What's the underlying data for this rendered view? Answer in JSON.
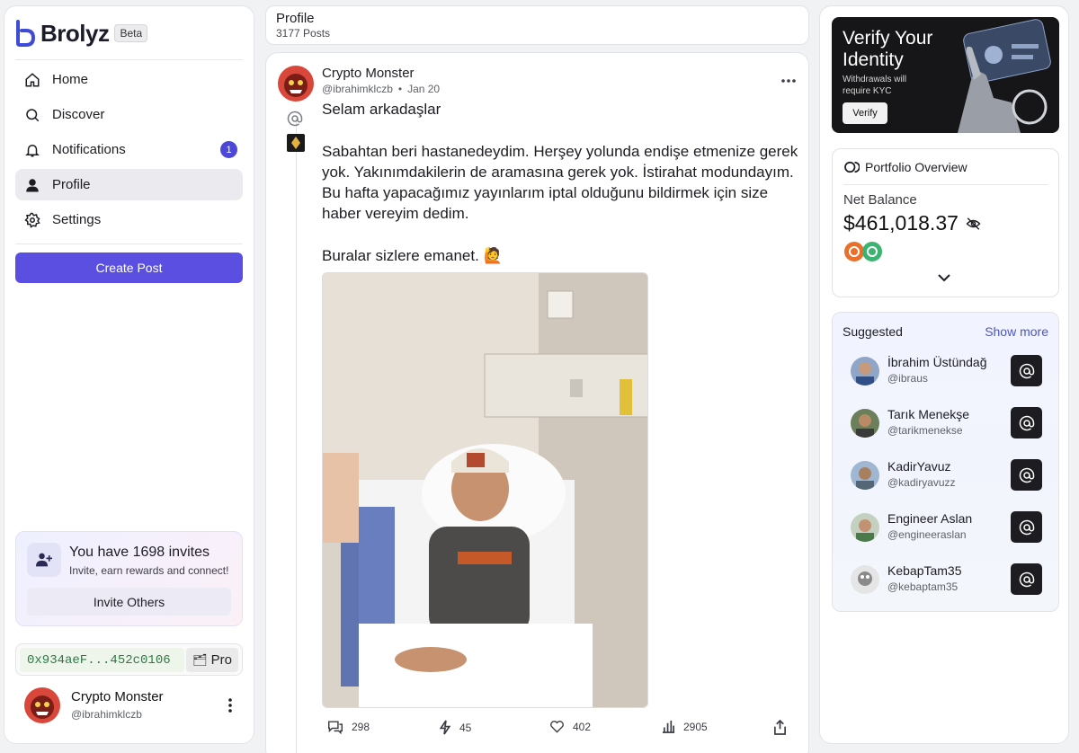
{
  "brand": {
    "name": "Brolyz",
    "badge": "Beta"
  },
  "nav": {
    "items": [
      {
        "label": "Home",
        "icon": "home-icon"
      },
      {
        "label": "Discover",
        "icon": "search-icon"
      },
      {
        "label": "Notifications",
        "icon": "bell-icon",
        "badge": "1"
      },
      {
        "label": "Profile",
        "icon": "user-icon",
        "active": true
      },
      {
        "label": "Settings",
        "icon": "gear-icon"
      }
    ],
    "create_label": "Create Post"
  },
  "invite": {
    "title": "You have 1698 invites",
    "subtitle": "Invite, earn rewards and connect!",
    "button": "Invite Others"
  },
  "wallet": {
    "address": "0x934aeF...452c0106",
    "pro_label": "Pro"
  },
  "current_user": {
    "name": "Crypto Monster",
    "handle": "@ibrahimklczb"
  },
  "profile_header": {
    "title": "Profile",
    "subtitle": "3177 Posts"
  },
  "post": {
    "author": "Crypto Monster",
    "handle": "@ibrahimklczb",
    "separator": "•",
    "date": "Jan 20",
    "text": "Selam arkadaşlar\n\nSabahtan beri hastanedeydim. Herşey yolunda endişe etmenize gerek yok. Yakınımdakilerin de aramasına gerek yok. İstirahat modundayım. Bu hafta yapacağımız yayınlarım iptal olduğunu bildirmek için size haber vereyim dedim.\n\nBuralar sizlere emanet. 🙋",
    "stats": {
      "comments": "298",
      "zaps": "45",
      "likes": "402",
      "views": "2905"
    }
  },
  "kyc": {
    "title": "Verify Your Identity",
    "text": "Withdrawals will require KYC",
    "button": "Verify"
  },
  "portfolio": {
    "title": "Portfolio Overview",
    "balance_label": "Net Balance",
    "balance": "$461,018.37",
    "token_colors": [
      "#e8702a",
      "#3cb371"
    ]
  },
  "suggested": {
    "title": "Suggested",
    "more": "Show more",
    "users": [
      {
        "name": "İbrahim Üstündağ",
        "handle": "@ibraus"
      },
      {
        "name": "Tarık Menekşe",
        "handle": "@tarikmenekse"
      },
      {
        "name": "KadirYavuz",
        "handle": "@kadiryavuzz"
      },
      {
        "name": "Engineer Aslan",
        "handle": "@engineeraslan"
      },
      {
        "name": "KebapTam35",
        "handle": "@kebaptam35"
      }
    ]
  },
  "colors": {
    "accent": "#5a4fe0",
    "badge": "#4c47d6",
    "link": "#4a56c6",
    "wallet_text": "#2e7a45"
  }
}
